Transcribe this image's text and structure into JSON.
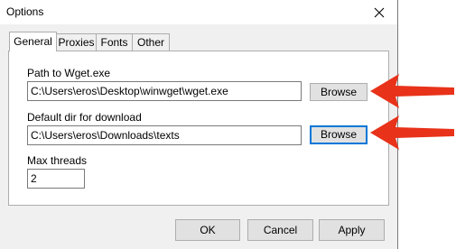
{
  "window": {
    "title": "Options"
  },
  "tabs": [
    {
      "label": "General",
      "active": true
    },
    {
      "label": "Proxies",
      "active": false
    },
    {
      "label": "Fonts",
      "active": false
    },
    {
      "label": "Other",
      "active": false
    }
  ],
  "general": {
    "wget_path": {
      "label": "Path to Wget.exe",
      "value": "C:\\Users\\eros\\Desktop\\winwget\\wget.exe",
      "browse_label": "Browse"
    },
    "download_dir": {
      "label": "Default dir for download",
      "value": "C:\\Users\\eros\\Downloads\\texts",
      "browse_label": "Browse"
    },
    "max_threads": {
      "label": "Max threads",
      "value": "2"
    }
  },
  "footer": {
    "ok_label": "OK",
    "cancel_label": "Cancel",
    "apply_label": "Apply"
  },
  "colors": {
    "accent": "#0078d7",
    "annotation_arrow": "#e8321a",
    "dialog_bg": "#f0f0f0"
  },
  "icons": {
    "close": "close-icon",
    "annotation": "arrow-left-icon"
  }
}
